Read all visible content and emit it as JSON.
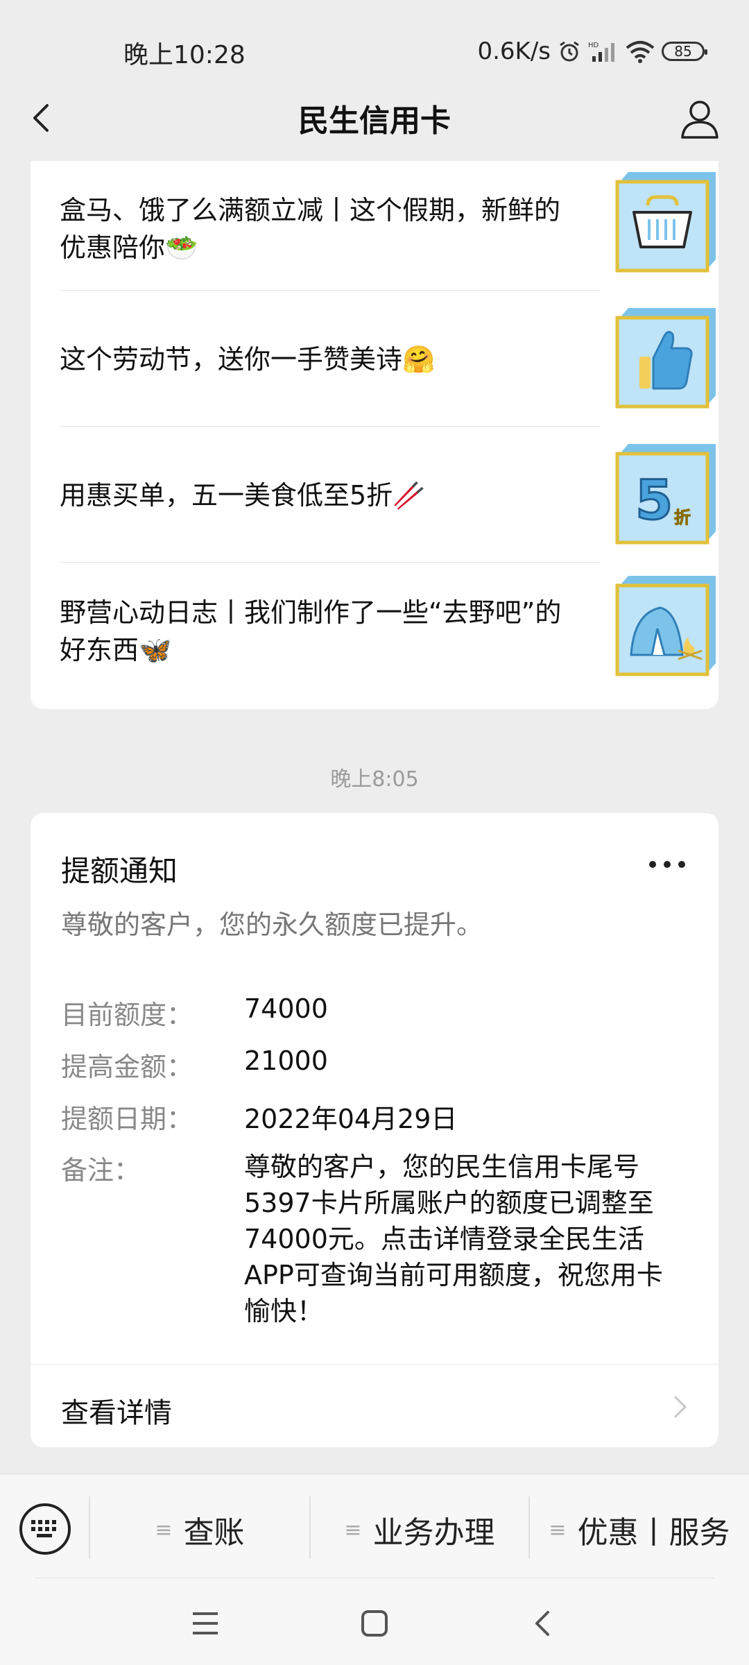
{
  "status_bar": {
    "time": "晚上10:28",
    "net_speed": "0.6K/s",
    "battery": "85",
    "icons": [
      "alarm-icon",
      "hd-signal-icon",
      "wifi-icon",
      "battery-icon"
    ]
  },
  "nav": {
    "title": "民生信用卡",
    "back_icon": "back-arrow-icon",
    "profile_icon": "user-profile-icon"
  },
  "articles": [
    {
      "title": "盒马、饿了么满额立减丨这个假期，新鲜的优惠陪你🥗",
      "thumb": "basket-icon"
    },
    {
      "title": "这个劳动节，送你一手赞美诗🤗",
      "thumb": "thumbs-up-icon"
    },
    {
      "title": "用惠买单，五一美食低至5折🥢",
      "thumb": "five-percent-off-icon"
    },
    {
      "title": "野营心动日志丨我们制作了一些“去野吧”的好东西🦋",
      "thumb": "tent-icon"
    }
  ],
  "timestamp": "晚上8:05",
  "notice": {
    "title": "提额通知",
    "subtitle": "尊敬的客户，您的永久额度已提升。",
    "fields": [
      {
        "label": "目前额度：",
        "value": "74000"
      },
      {
        "label": "提高金额：",
        "value": "21000"
      },
      {
        "label": "提额日期：",
        "value": "2022年04月29日"
      }
    ],
    "remark_label": "备注：",
    "remark": "尊敬的客户，您的民生信用卡尾号5397卡片所属账户的额度已调整至74000元。点击详情登录全民生活APP可查询当前可用额度，祝您用卡愉快！",
    "detail_link": "查看详情"
  },
  "menu": {
    "items": [
      "查账",
      "业务办理",
      "优惠丨服务"
    ],
    "bars_glyph": "≡"
  }
}
